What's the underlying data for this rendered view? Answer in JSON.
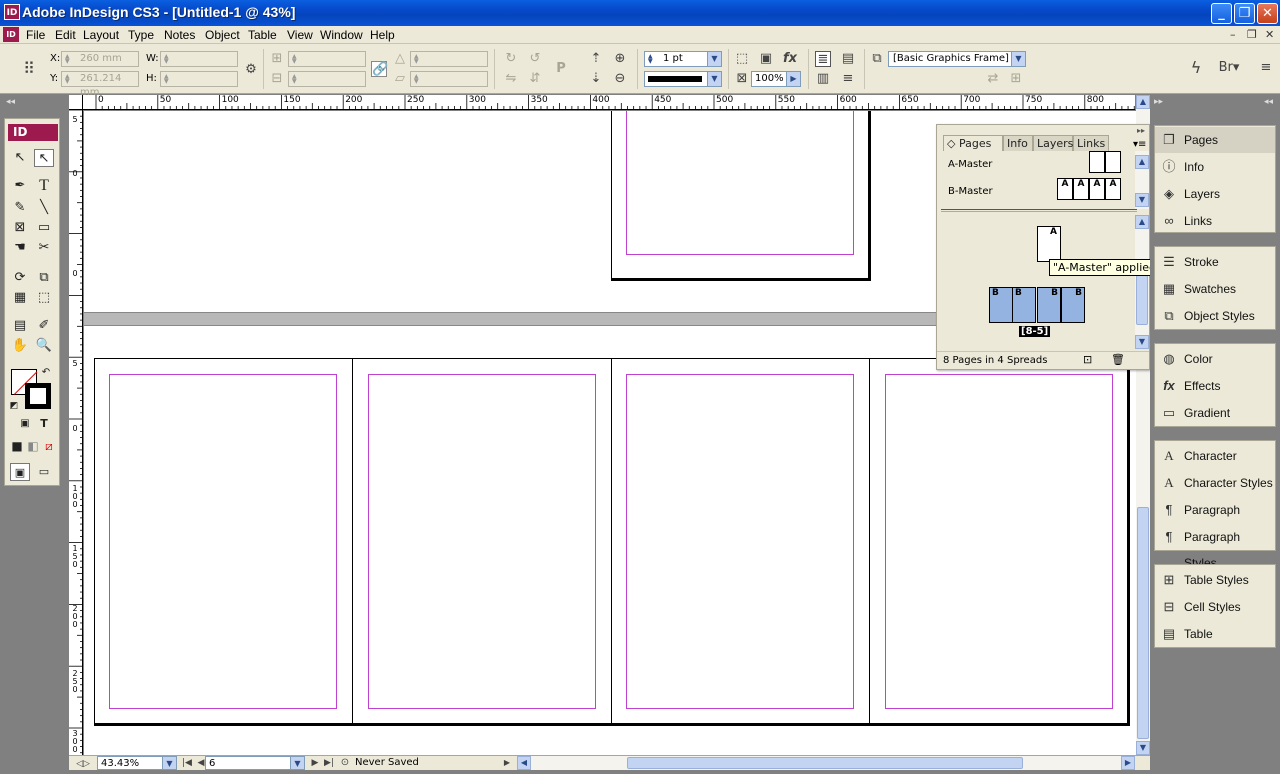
{
  "window": {
    "title": "Adobe InDesign CS3 - [Untitled-1 @ 43%]",
    "app_badge": "ID"
  },
  "menu": [
    "File",
    "Edit",
    "Layout",
    "Type",
    "Notes",
    "Object",
    "Table",
    "View",
    "Window",
    "Help"
  ],
  "control": {
    "x_label": "X:",
    "y_label": "Y:",
    "w_label": "W:",
    "h_label": "H:",
    "x_value": "260 mm",
    "y_value": "261.214 mm",
    "stroke_weight": "1 pt",
    "opacity": "100%",
    "object_style": "[Basic Graphics Frame]"
  },
  "ruler_top_labels": [
    "0",
    "50",
    "100",
    "150",
    "200",
    "250",
    "300",
    "350",
    "400",
    "450",
    "500",
    "550",
    "600",
    "650",
    "700",
    "750",
    "800"
  ],
  "ruler_left_labels": [
    "5",
    "0",
    "0",
    "5",
    "0",
    "1\n0\n0",
    "1\n5\n0",
    "2\n0\n0",
    "2\n5\n0",
    "3\n0\n0"
  ],
  "pages_panel": {
    "tabs": [
      "Pages",
      "Info",
      "Layers",
      "Links"
    ],
    "masters": [
      "A-Master",
      "B-Master"
    ],
    "b_master_pages": [
      "A",
      "A",
      "A",
      "A"
    ],
    "single_page_label": "A",
    "tooltip": "\"A-Master\" applied",
    "spread_pages": [
      "B",
      "B",
      "B",
      "B"
    ],
    "spread_label": "[8-5]",
    "status": "8 Pages in 4 Spreads"
  },
  "dock": {
    "group1": [
      "Pages",
      "Info",
      "Layers",
      "Links"
    ],
    "group2": [
      "Stroke",
      "Swatches",
      "Object Styles"
    ],
    "group3": [
      "Color",
      "Effects",
      "Gradient"
    ],
    "group4": [
      "Character",
      "Character Styles",
      "Paragraph",
      "Paragraph Styles"
    ],
    "group5": [
      "Table Styles",
      "Cell Styles",
      "Table"
    ]
  },
  "status_bar": {
    "zoom": "43.43%",
    "page": "6",
    "save_state": "Never Saved"
  }
}
